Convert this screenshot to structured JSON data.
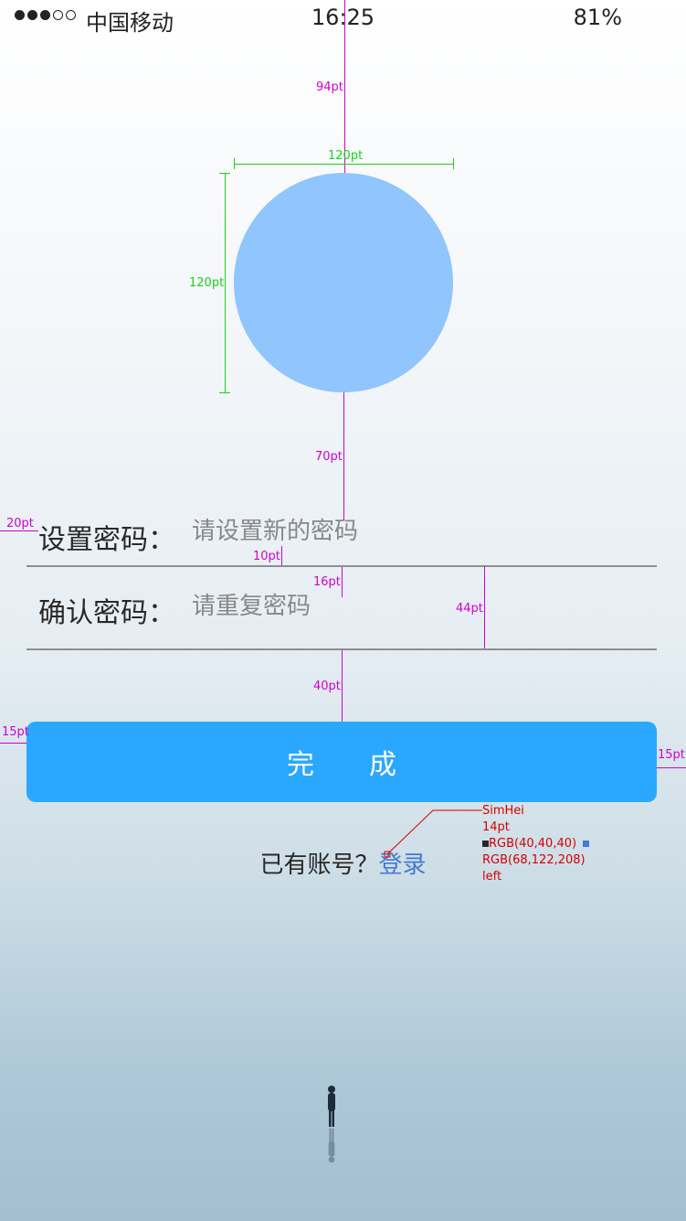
{
  "status_bar": {
    "carrier": "中国移动",
    "time": "16:25",
    "battery": "81%"
  },
  "form": {
    "set_password_label": "设置密码：",
    "set_password_placeholder": "请设置新的密码",
    "confirm_password_label": "确认密码：",
    "confirm_password_placeholder": "请重复密码"
  },
  "done_button": "完成",
  "login_prompt": "已有账号？",
  "login_link": "登录",
  "spec_annotations": {
    "top_gap": "94pt",
    "avatar_width": "120pt",
    "avatar_height": "120pt",
    "avatar_bottom_gap": "70pt",
    "left_margin": "20pt",
    "label_gap": "10pt",
    "row_gap": "16pt",
    "row_height": "44pt",
    "button_gap": "40pt",
    "button_left": "15pt",
    "button_right": "15pt",
    "font_name": "SimHei",
    "font_size": "14pt",
    "text_color": "RGB(40,40,40)",
    "link_color": "RGB(68,122,208)",
    "alignment": "left"
  },
  "colors": {
    "avatar": "#90c5fd",
    "button": "#2aa8ff",
    "link": "#447ad0",
    "text": "#282828"
  }
}
